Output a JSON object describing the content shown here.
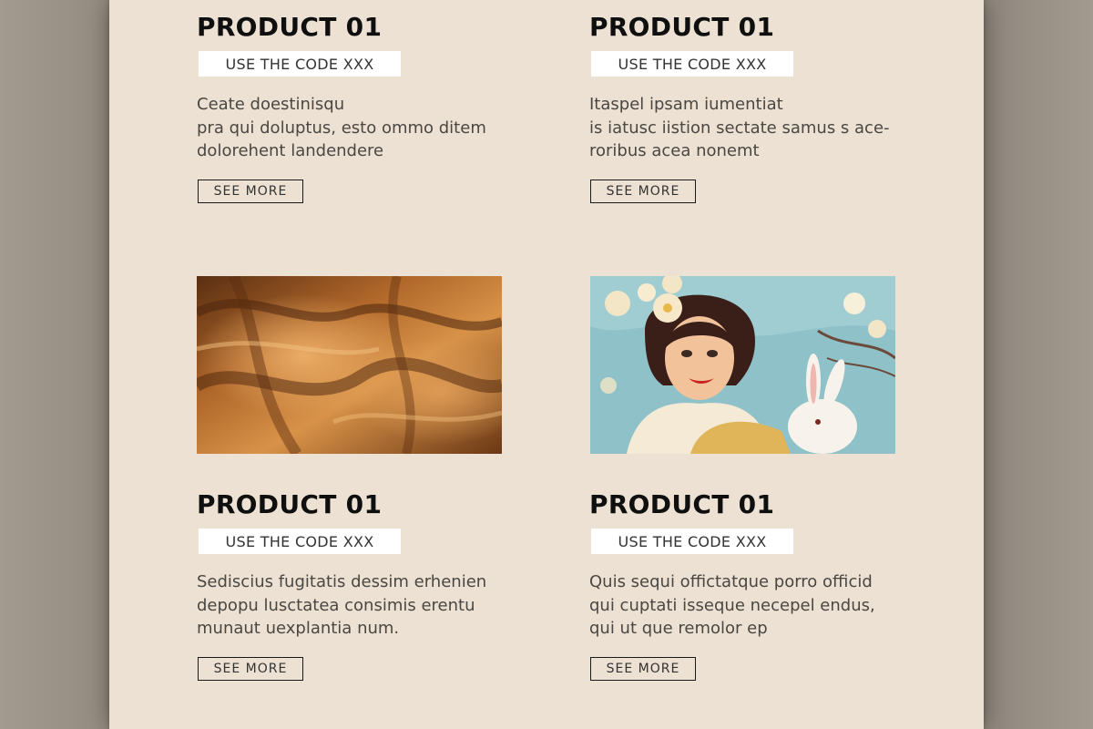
{
  "cards": [
    {
      "title": "PRODUCT 01",
      "code": "USE THE CODE XXX",
      "desc_lines": [
        "Ceate doestinisqu",
        "pra qui doluptus, esto ommo ditem",
        "dolorehent landendere"
      ],
      "cta": "SEE MORE"
    },
    {
      "title": "PRODUCT 01",
      "code": "USE THE CODE XXX",
      "desc_lines": [
        "Itaspel ipsam iumentiat",
        "is iatusc iistion sectate samus s ace-",
        "roribus acea nonemt"
      ],
      "cta": "SEE MORE"
    },
    {
      "title": "PRODUCT 01",
      "code": "USE THE CODE XXX",
      "desc_lines": [
        "Sediscius fugitatis dessim erhenien",
        "depopu lusctatea consimis erentu",
        "munaut uexplantia num."
      ],
      "cta": "SEE MORE"
    },
    {
      "title": "PRODUCT 01",
      "code": "USE THE CODE XXX",
      "desc_lines": [
        "Quis sequi offictatque porro officid",
        "qui cuptati isseque necepel endus,",
        "qui ut que remolor ep"
      ],
      "cta": "SEE MORE"
    }
  ],
  "images": [
    {
      "subject": "brown-leather-fabric"
    },
    {
      "subject": "retro-pinup-woman-with-bunny"
    }
  ],
  "colors": {
    "outer_background": "#9e968b",
    "page_background": "#ede1d3",
    "title_text": "#0f0f0f",
    "body_text": "#4a4742",
    "code_box": "#ffffff",
    "button_border": "#1a1a1a"
  }
}
